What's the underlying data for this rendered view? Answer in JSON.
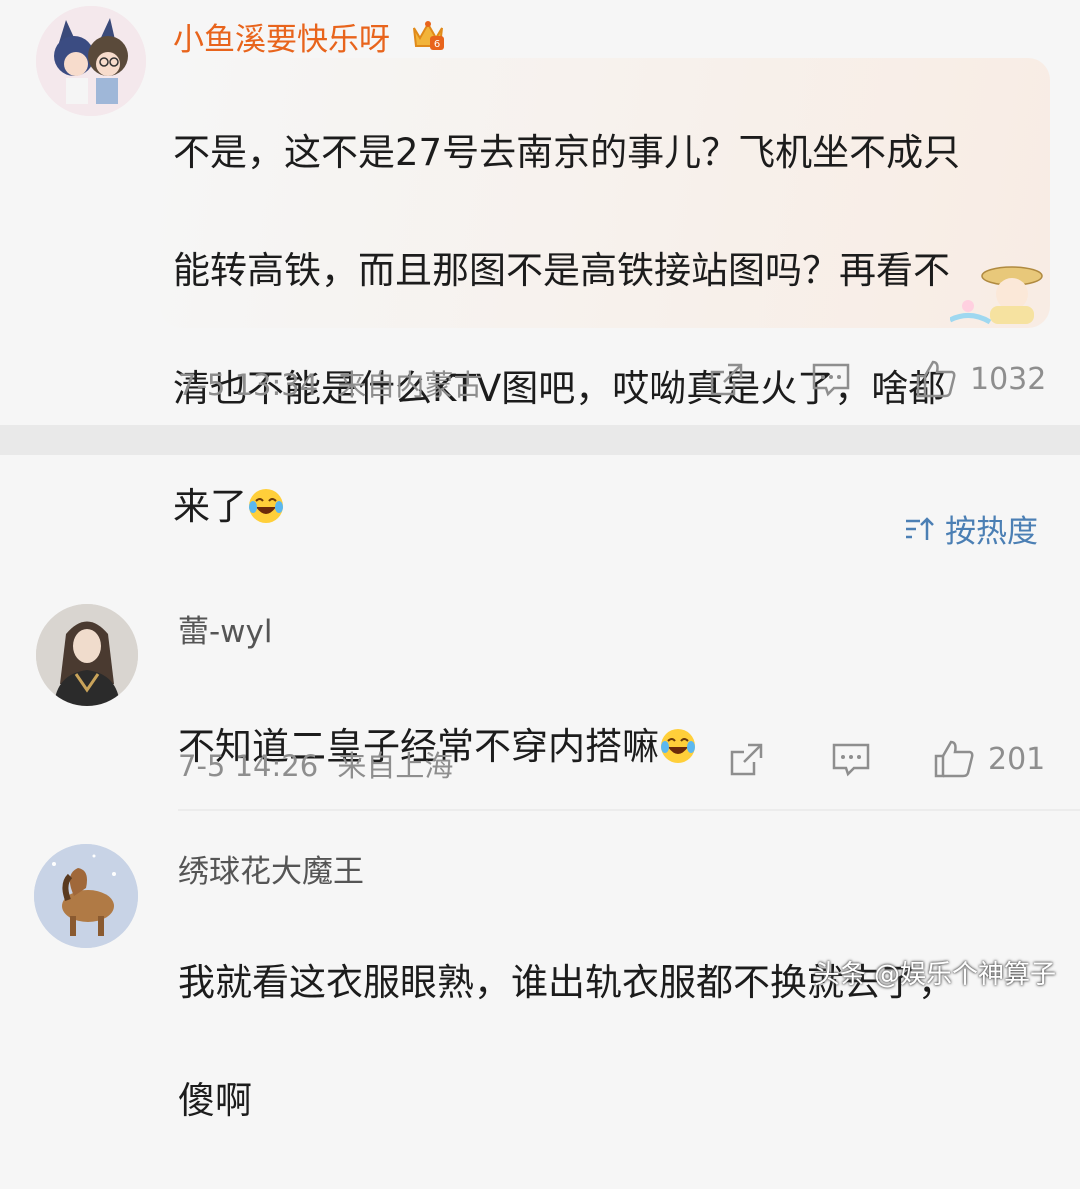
{
  "comments": [
    {
      "username": "小鱼溪要快乐呀",
      "username_color": "#e8641c",
      "badge_icon": "crown-badge-icon",
      "text": "不是，这不是27号去南京的事儿？飞机坐不成只能转高铁，而且那图不是高铁接站图吗？再看不清也不能是什么KTV图吧，哎呦真是火了，啥都来了",
      "lines": [
        "不是，这不是27号去南京的事儿？飞机坐不成只",
        "能转高铁，而且那图不是高铁接站图吗？再看不",
        "清也不能是什么KTV图吧，哎呦真是火了，啥都",
        "来了"
      ],
      "emoji": "laugh-cry-emoji",
      "time": "7-5 13:34",
      "location": "来自内蒙古",
      "likes": "1032"
    },
    {
      "username": "蕾-wyl",
      "username_color": "#555555",
      "text": "不知道二皇子经常不穿内搭嘛",
      "emoji": "laugh-cry-emoji",
      "time": "7-5 14:26",
      "location": "来自上海",
      "likes": "201"
    },
    {
      "username": "绣球花大魔王",
      "username_color": "#555555",
      "lines": [
        "我就看这衣服眼熟，谁出轨衣服都不换就去了，",
        "傻啊"
      ],
      "text": "我就看这衣服眼熟，谁出轨衣服都不换就去了，傻啊"
    }
  ],
  "sort": {
    "label": "按热度",
    "icon": "sort-icon",
    "color": "#4b7fb4"
  },
  "watermark": "头条 @娱乐个神算子"
}
